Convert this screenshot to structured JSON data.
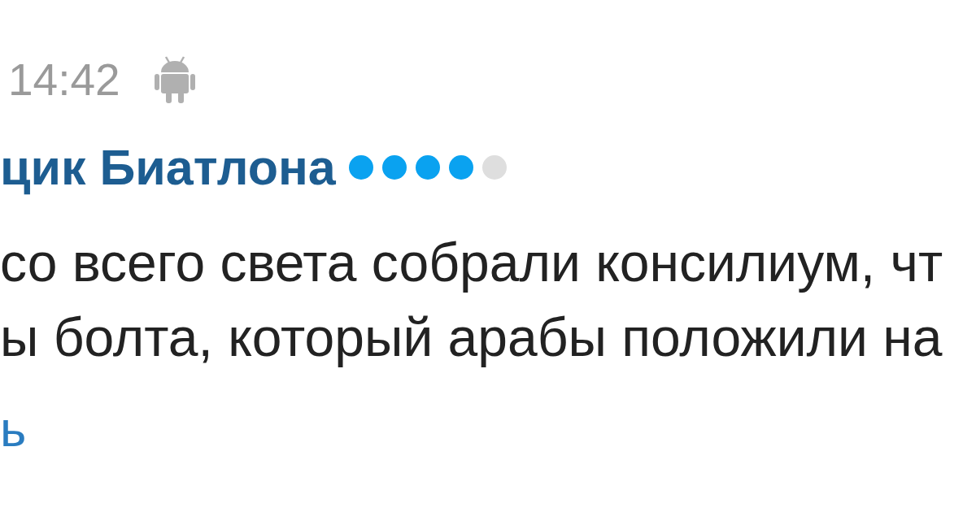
{
  "comment": {
    "time": "14:42",
    "author": {
      "name": "цик Биатлона",
      "stars": 4
    },
    "text_lines": [
      "со всего света собрали консилиум, чт",
      "ы болта, который арабы положили на"
    ],
    "reply_link": "ь"
  }
}
